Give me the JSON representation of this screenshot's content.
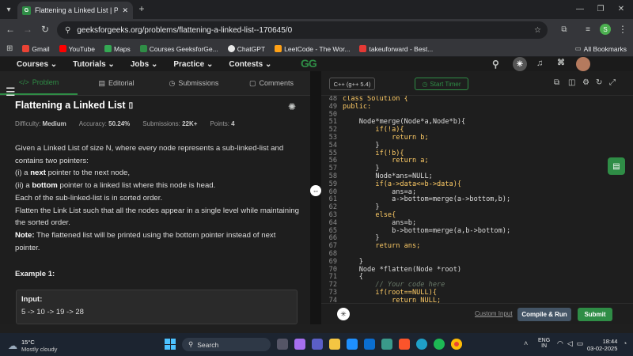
{
  "browser": {
    "tab_title": "Flattening a Linked List | Practic",
    "favicon_text": "G",
    "url": "geeksforgeeks.org/problems/flattening-a-linked-list--170645/0",
    "profile_initial": "S",
    "bookmarks": [
      "Gmail",
      "YouTube",
      "Maps",
      "Courses GeeksforGe...",
      "ChatGPT",
      "LeetCode - The Wor...",
      "takeuforward - Best..."
    ],
    "all_bookmarks": "All Bookmarks"
  },
  "site_nav": {
    "items": [
      "Courses ⌄",
      "Tutorials ⌄",
      "Jobs ⌄",
      "Practice ⌄",
      "Contests ⌄"
    ],
    "logo": "GG"
  },
  "problem_tabs": [
    "Problem",
    "Editorial",
    "Submissions",
    "Comments"
  ],
  "problem": {
    "title": "Flattening a Linked List",
    "difficulty_label": "Difficulty:",
    "difficulty": "Medium",
    "accuracy_label": "Accuracy:",
    "accuracy": "50.24%",
    "submissions_label": "Submissions:",
    "submissions": "22K+",
    "points_label": "Points:",
    "points": "4",
    "desc": {
      "l1": "Given a Linked List of size N, where every node represents a sub-linked-list and contains two pointers:",
      "l2a": "(i) a ",
      "l2b": "next",
      "l2c": " pointer to the next node,",
      "l3a": "(ii) a ",
      "l3b": "bottom",
      "l3c": " pointer to a linked list where this node is head.",
      "l4": "Each of the sub-linked-list is in sorted order.",
      "l5": "Flatten the Link List such that all the nodes appear in a single level while maintaining the sorted order.",
      "l6a": "Note:",
      "l6b": " The flattened list will be printed using the bottom pointer instead of next pointer."
    },
    "example_title": "Example 1:",
    "input_label": "Input:",
    "input_line": "5 -> 10 -> 19 -> 28"
  },
  "editor": {
    "language": "C++ (g++ 5.4)",
    "timer": "Start Timer",
    "custom_input": "Custom Input",
    "compile_run": "Compile & Run",
    "submit": "Submit",
    "lines": [
      {
        "n": "48",
        "t": "class Solution {"
      },
      {
        "n": "49",
        "t": "public:"
      },
      {
        "n": "50",
        "t": ""
      },
      {
        "n": "51",
        "t": "    Node*merge(Node*a,Node*b){"
      },
      {
        "n": "52",
        "t": "        if(!a){"
      },
      {
        "n": "53",
        "t": "            return b;"
      },
      {
        "n": "54",
        "t": "        }"
      },
      {
        "n": "55",
        "t": "        if(!b){"
      },
      {
        "n": "56",
        "t": "            return a;"
      },
      {
        "n": "57",
        "t": "        }"
      },
      {
        "n": "58",
        "t": "        Node*ans=NULL;"
      },
      {
        "n": "59",
        "t": "        if(a->data<=b->data){"
      },
      {
        "n": "60",
        "t": "            ans=a;"
      },
      {
        "n": "61",
        "t": "            a->bottom=merge(a->bottom,b);"
      },
      {
        "n": "62",
        "t": "        }"
      },
      {
        "n": "63",
        "t": "        else{"
      },
      {
        "n": "64",
        "t": "            ans=b;"
      },
      {
        "n": "65",
        "t": "            b->bottom=merge(a,b->bottom);"
      },
      {
        "n": "66",
        "t": "        }"
      },
      {
        "n": "67",
        "t": "        return ans;"
      },
      {
        "n": "68",
        "t": ""
      },
      {
        "n": "69",
        "t": "    }"
      },
      {
        "n": "70",
        "t": "    Node *flatten(Node *root)"
      },
      {
        "n": "71",
        "t": "    {"
      },
      {
        "n": "72",
        "t": "        // Your code here"
      },
      {
        "n": "73",
        "t": "        if(root==NULL){"
      },
      {
        "n": "74",
        "t": "            return NULL;"
      },
      {
        "n": "75",
        "t": "        }"
      }
    ]
  },
  "taskbar": {
    "temp": "15°C",
    "weather": "Mostly cloudy",
    "search": "Search",
    "lang1": "ENG",
    "lang2": "IN",
    "time": "18:44",
    "date": "03-02-2025"
  },
  "colors": {
    "accent": "#2f8d46",
    "bg": "#1e1e1e",
    "taskbar": "#1c2430"
  }
}
